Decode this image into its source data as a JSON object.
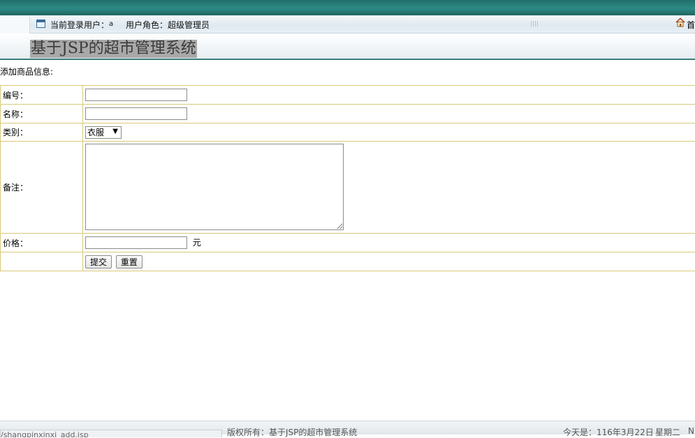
{
  "header": {
    "current_user_label": "当前登录用户：",
    "current_user_value": "a",
    "role_label": "用户角色：",
    "role_value": "超级管理员",
    "home_label": "首"
  },
  "system_title": "基于JSP的超市管理系统",
  "form": {
    "section_title": "添加商品信息:",
    "fields": {
      "id_label": "编号：",
      "id_value": "",
      "name_label": "名称：",
      "name_value": "",
      "category_label": "类别：",
      "category_selected": "衣服",
      "remark_label": "备注：",
      "remark_value": "",
      "price_label": "价格：",
      "price_value": "",
      "price_unit": "元"
    },
    "buttons": {
      "submit": "提交",
      "reset": "重置"
    }
  },
  "footer": {
    "status_url": "/shangpinxinxi_add.jsp",
    "copyright": "版权所有：基于JSP的超市管理系统",
    "date": "今天是：116年3月22日",
    "weekday": "星期二",
    "extra": "N"
  },
  "colors": {
    "topbar": "#2e8a84",
    "table_border": "#d8c97a",
    "title_highlight": "#a9a9a9"
  }
}
